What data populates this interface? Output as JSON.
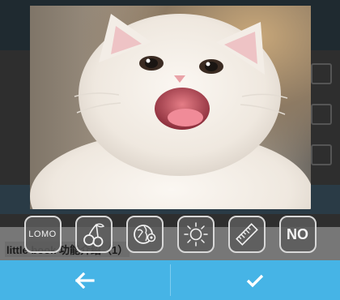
{
  "background": {
    "article_title": "little book 功能介绍（1）"
  },
  "filters": [
    {
      "id": "lomo",
      "label": "LOMO",
      "icon": "lomo-text"
    },
    {
      "id": "cherry",
      "label": "",
      "icon": "cherry-icon"
    },
    {
      "id": "globe",
      "label": "",
      "icon": "globe-gear-icon"
    },
    {
      "id": "sun",
      "label": "",
      "icon": "sun-icon"
    },
    {
      "id": "ruler",
      "label": "",
      "icon": "ruler-icon"
    },
    {
      "id": "none",
      "label": "NO",
      "icon": "no-text"
    }
  ],
  "actions": {
    "back_icon": "arrow-left-icon",
    "confirm_icon": "checkmark-icon"
  },
  "colors": {
    "action_bar": "#46b4e6",
    "button_border": "#d8d8d8"
  }
}
